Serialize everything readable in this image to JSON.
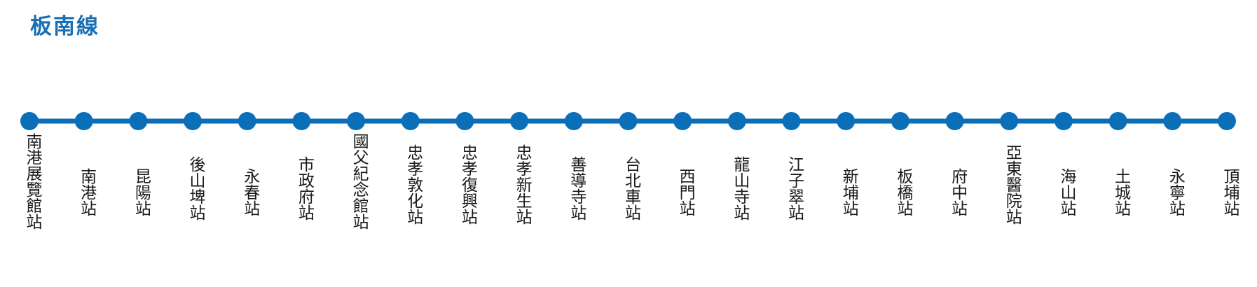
{
  "line": {
    "name": "板南線",
    "color": "#0a6fb8"
  },
  "stations": [
    "南港展覽館站",
    "南港站",
    "昆陽站",
    "後山埤站",
    "永春站",
    "市政府站",
    "國父紀念館站",
    "忠孝敦化站",
    "忠孝復興站",
    "忠孝新生站",
    "善導寺站",
    "台北車站",
    "西門站",
    "龍山寺站",
    "江子翠站",
    "新埔站",
    "板橋站",
    "府中站",
    "亞東醫院站",
    "海山站",
    "土城站",
    "永寧站",
    "頂埔站"
  ]
}
